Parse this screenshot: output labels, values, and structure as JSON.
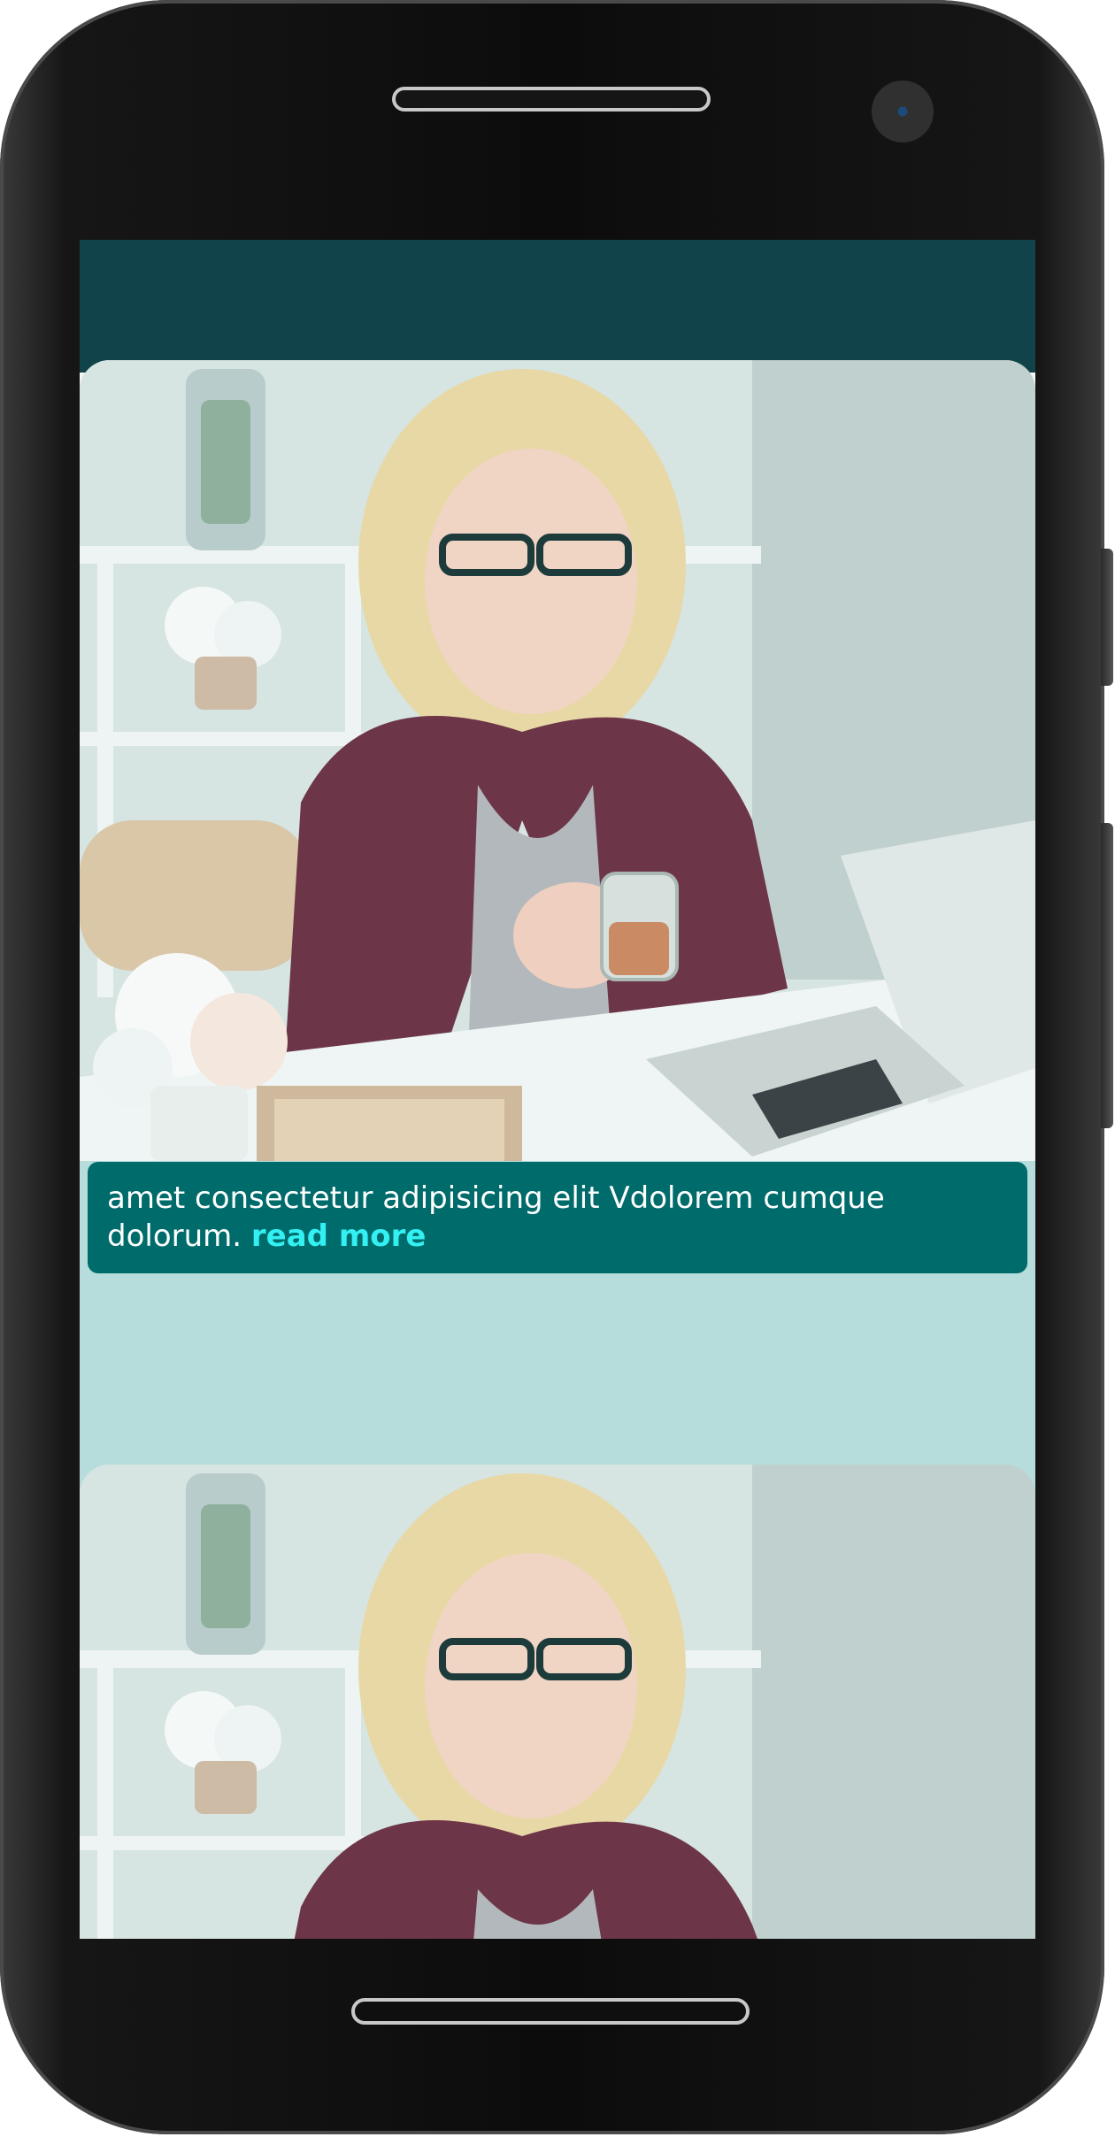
{
  "device": {
    "icons": [
      "speaker-grille",
      "front-camera",
      "home-bar"
    ]
  },
  "app": {
    "header_color": "#11444a",
    "accent_color": "#33f0f2",
    "caption_bg": "#006b6b"
  },
  "cards": [
    {
      "image_alt": "woman with glasses holding a glass of tea at a desk with a laptop",
      "caption_text": "amet consectetur adipisicing elit Vdolorem cumque dolorum.",
      "read_more_label": "read more"
    },
    {
      "image_alt": "woman with glasses holding a glass of tea at a desk with a laptop"
    }
  ]
}
